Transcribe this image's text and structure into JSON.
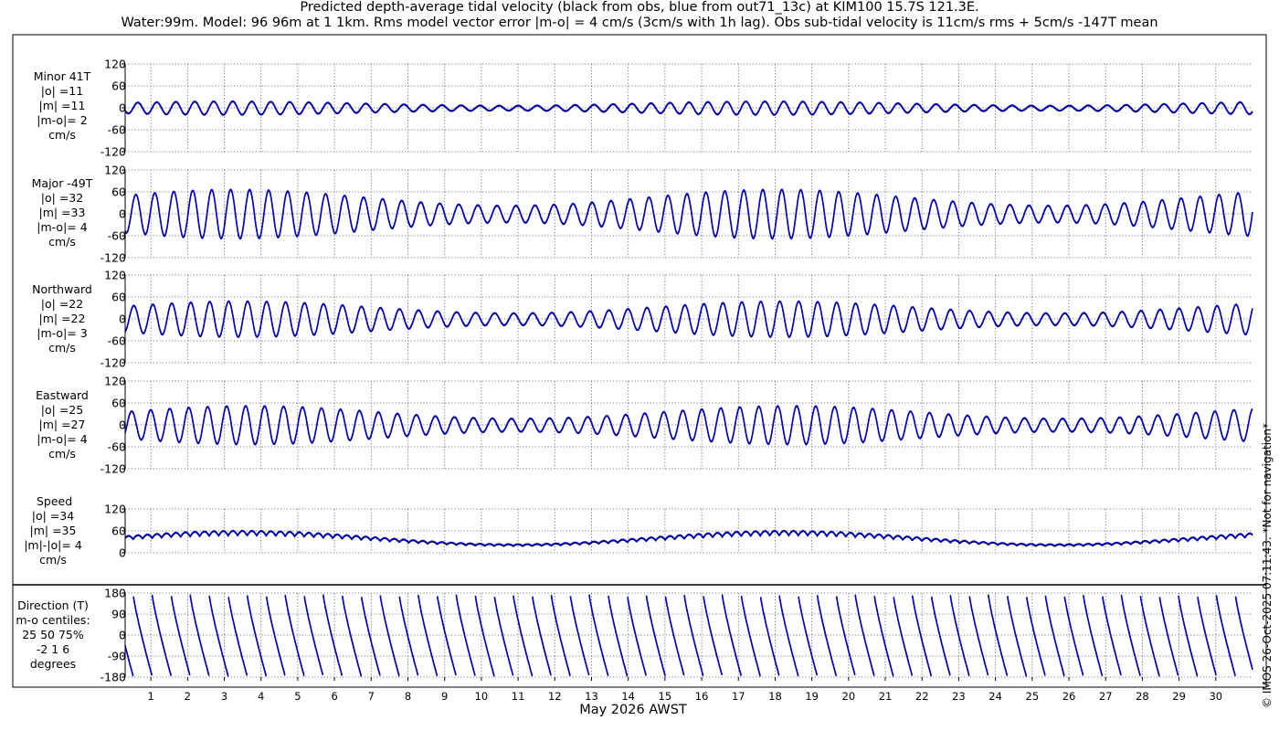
{
  "title": {
    "line1": "Predicted depth-average tidal velocity (black from obs, blue from out71_13c) at KIM100 15.7S 121.3E.",
    "line2": "Water:99m. Model: 96 96m at 1 1km. Rms model vector error |m-o| = 4 cm/s (3cm/s with 1h lag). Obs sub-tidal velocity is 11cm/s rms + 5cm/s -147T mean"
  },
  "xlabel": "May 2026 AWST",
  "credit": "© IMOS 26-Oct-2025 07:11:43. *Not for navigation*",
  "colors": {
    "obs": "#000000",
    "model": "#0000cc",
    "grid": "#555555"
  },
  "chart_data": {
    "type": "line",
    "x_ticks": [
      "1",
      "2",
      "3",
      "4",
      "5",
      "6",
      "7",
      "8",
      "9",
      "10",
      "11",
      "12",
      "13",
      "14",
      "15",
      "16",
      "17",
      "18",
      "19",
      "20",
      "21",
      "22",
      "23",
      "24",
      "25",
      "26",
      "27",
      "28",
      "29",
      "30"
    ],
    "x_range_days": [
      0.3,
      31.0
    ],
    "tidal_constituents": {
      "m2_period_hours": 12.42,
      "s2_period_hours": 12.0,
      "spring_neap_cycle_days": 14.77,
      "spring_days": [
        3.5,
        18.3
      ]
    },
    "panels": [
      {
        "id": "minor",
        "label": [
          "Minor 41T",
          "|o| =11",
          "|m| =11",
          "|m-o|= 2",
          "cm/s"
        ],
        "yticks": [
          "120",
          "60",
          "0",
          "-60",
          "-120"
        ],
        "ylim": [
          -120,
          120
        ],
        "kind": "wave",
        "peak_amplitude_cm_s": 18
      },
      {
        "id": "major",
        "label": [
          "Major -49T",
          "|o| =32",
          "|m| =33",
          "|m-o|= 4",
          "cm/s"
        ],
        "yticks": [
          "120",
          "60",
          "0",
          "-60",
          "-120"
        ],
        "ylim": [
          -120,
          120
        ],
        "kind": "wave",
        "peak_amplitude_cm_s": 64
      },
      {
        "id": "north",
        "label": [
          "Northward",
          "|o| =22",
          "|m| =22",
          "|m-o|= 3",
          "cm/s"
        ],
        "yticks": [
          "120",
          "60",
          "0",
          "-60",
          "-120"
        ],
        "ylim": [
          -120,
          120
        ],
        "kind": "wave",
        "peak_amplitude_cm_s": 46
      },
      {
        "id": "east",
        "label": [
          "Eastward",
          "|o| =25",
          "|m| =27",
          "|m-o|= 4",
          "cm/s"
        ],
        "yticks": [
          "120",
          "60",
          "0",
          "-60",
          "-120"
        ],
        "ylim": [
          -120,
          120
        ],
        "kind": "wave",
        "peak_amplitude_cm_s": 50
      },
      {
        "id": "speed",
        "label": [
          "Speed",
          "|o| =34",
          "|m| =35",
          "|m|-|o|= 4",
          "cm/s"
        ],
        "yticks": [
          "120",
          "60",
          "0"
        ],
        "ylim": [
          0,
          120
        ],
        "kind": "speed",
        "peak_amplitude_cm_s": 64
      },
      {
        "id": "direction",
        "label": [
          "Direction (T)",
          "m-o centiles:",
          "25  50  75%",
          "-2  1  6",
          "degrees"
        ],
        "yticks": [
          "180",
          "90",
          "0",
          "-90",
          "-180"
        ],
        "ylim": [
          -180,
          180
        ],
        "kind": "direction"
      }
    ]
  }
}
